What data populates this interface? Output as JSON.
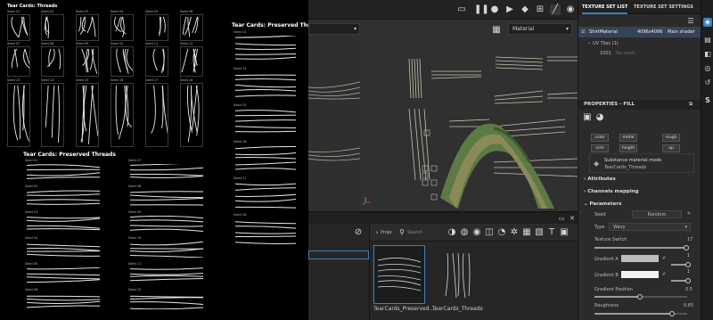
{
  "sheet": {
    "title_small": "Tear Cards: Threads",
    "seeds_small": [
      "Seed 01",
      "Seed 02",
      "Seed 03",
      "Seed 04",
      "Seed 05",
      "Seed 06",
      "Seed 07",
      "Seed 08",
      "Seed 09",
      "Seed 10",
      "Seed 11",
      "Seed 12",
      "Seed 13",
      "Seed 14",
      "Seed 15",
      "Seed 16",
      "Seed 17",
      "Seed 18"
    ],
    "title_mid": "Tear Cards: Preserved Threads",
    "seeds_mid_col1": [
      "Seed 01",
      "Seed 02",
      "Seed 03",
      "Seed 04",
      "Seed 05",
      "Seed 06"
    ],
    "seeds_mid_col2": [
      "Seed 07",
      "Seed 08",
      "Seed 09",
      "Seed 10",
      "Seed 11",
      "Seed 12"
    ],
    "title_right": "Tear Cards: Preserved Threads",
    "seeds_right": [
      "Seed 13",
      "Seed 14",
      "Seed 15",
      "Seed 16",
      "Seed 17",
      "Seed 18"
    ]
  },
  "viewport": {
    "material_dropdown": "Material"
  },
  "shelf": {
    "search_placeholder": "Search",
    "breadcrumb": "Proje",
    "thumbs": [
      {
        "label": "TearCards_Preserved..."
      },
      {
        "label": "TearCards_Threads"
      }
    ]
  },
  "panel": {
    "tab_texture_set_list": "TEXTURE SET LIST",
    "tab_texture_set_settings": "TEXTURE SET SETTINGS",
    "material_name": "ShirtMaterial",
    "resolution": "4096x4096",
    "shader": "Main shader",
    "uv_tiles": "UV Tiles (1)",
    "uv_tile_id": "1001",
    "uv_tile_note": "No mask",
    "properties_title": "PROPERTIES - FILL",
    "channels": [
      "color",
      "metal",
      "rough",
      "nrm",
      "height",
      "op"
    ],
    "substance_mode": "Substance material mode",
    "substance_name": "TearCards_Threads",
    "section_attributes": "Attributes",
    "section_channels_mapping": "Channels mapping",
    "section_parameters": "Parameters",
    "seed_label": "Seed",
    "seed_value": "Random",
    "type_label": "Type",
    "type_value": "Wavy",
    "texture_switch_label": "Texture Switch",
    "texture_switch_value": "17",
    "texture_switch_fraction": 1.0,
    "gradient_a_label": "Gradient A",
    "gradient_a_value": "1",
    "gradient_b_label": "Gradient B",
    "gradient_b_value": "1",
    "gradient_position_label": "Gradient Position",
    "gradient_position_value": "0.5",
    "gradient_position_fraction": 0.5,
    "roughness_label": "Roughness",
    "roughness_value": "0.85",
    "roughness_fraction": 0.85,
    "gradient_a_color": "#bdbdbd",
    "gradient_b_color": "#f2f2f2"
  },
  "colors": {
    "accent": "#3d7fc0",
    "selection_row": "#344456"
  }
}
